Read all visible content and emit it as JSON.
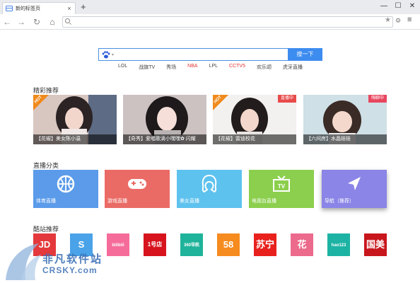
{
  "tab": {
    "title": "新的标签页"
  },
  "nav": {
    "address_value": ""
  },
  "search": {
    "button_label": "搜一下",
    "placeholder": ""
  },
  "hotwords": [
    {
      "label": "LOL",
      "red": false
    },
    {
      "label": "战旗TV",
      "red": false
    },
    {
      "label": "秀场",
      "red": false
    },
    {
      "label": "NBA",
      "red": true
    },
    {
      "label": "LPL",
      "red": false
    },
    {
      "label": "CCTV5",
      "red": true
    },
    {
      "label": "欢乐颂",
      "red": false
    },
    {
      "label": "虎牙直播",
      "red": false
    }
  ],
  "featured": {
    "title": "精彩推荐",
    "cards": [
      {
        "caption": "【花椒】美女陈小温",
        "badge": "HOT",
        "badge_type": "hot"
      },
      {
        "caption": "【奇秀】爱唱歌滴小嘿嘿✿ 闪耀",
        "badge": "",
        "badge_type": ""
      },
      {
        "caption": "【花椒】雷迪校花",
        "badge": "HOT",
        "badge_type": "hot",
        "live": "直播中"
      },
      {
        "caption": "【六间房】水晶娃娃",
        "badge": "",
        "badge_type": "",
        "live": "嗨聊中"
      }
    ]
  },
  "categories": {
    "title": "直播分类",
    "tiles": [
      {
        "label": "体育直播",
        "color": "#5b9bea",
        "icon": "basketball-icon"
      },
      {
        "label": "游戏直播",
        "color": "#ea6b66",
        "icon": "gamepad-icon"
      },
      {
        "label": "美女直播",
        "color": "#5ec2ee",
        "icon": "girl-icon"
      },
      {
        "label": "电视台直播",
        "color": "#8ccf4e",
        "icon": "tv-icon"
      },
      {
        "label": "导航（推荐）",
        "color": "#8a85e6",
        "icon": "navigation-icon"
      }
    ]
  },
  "sites": {
    "title": "酷站推荐",
    "items": [
      {
        "label": "JD",
        "color": "#e4393c",
        "icon": "jd-logo-icon"
      },
      {
        "label": "S",
        "color": "#4aa3e8",
        "icon": "sogou-logo-icon"
      },
      {
        "label": "bilibili",
        "color": "#f56c9a",
        "icon": "bilibili-logo-icon"
      },
      {
        "label": "1号店",
        "color": "#d7141e",
        "icon": "yhd-logo-icon"
      },
      {
        "label": "360导航",
        "color": "#1eb39a",
        "icon": "360-logo-icon"
      },
      {
        "label": "58",
        "color": "#f68b1f",
        "icon": "58-logo-icon"
      },
      {
        "label": "苏宁",
        "color": "#e8211d",
        "icon": "suning-logo-icon"
      },
      {
        "label": "花",
        "color": "#ec6a8c",
        "icon": "flower-logo-icon"
      },
      {
        "label": "hao123",
        "color": "#1db3a4",
        "icon": "hao123-logo-icon"
      },
      {
        "label": "国美",
        "color": "#c8161d",
        "icon": "gome-logo-icon"
      }
    ]
  },
  "watermark": {
    "text": "非凡软件站",
    "url": "CRSKY.com"
  }
}
